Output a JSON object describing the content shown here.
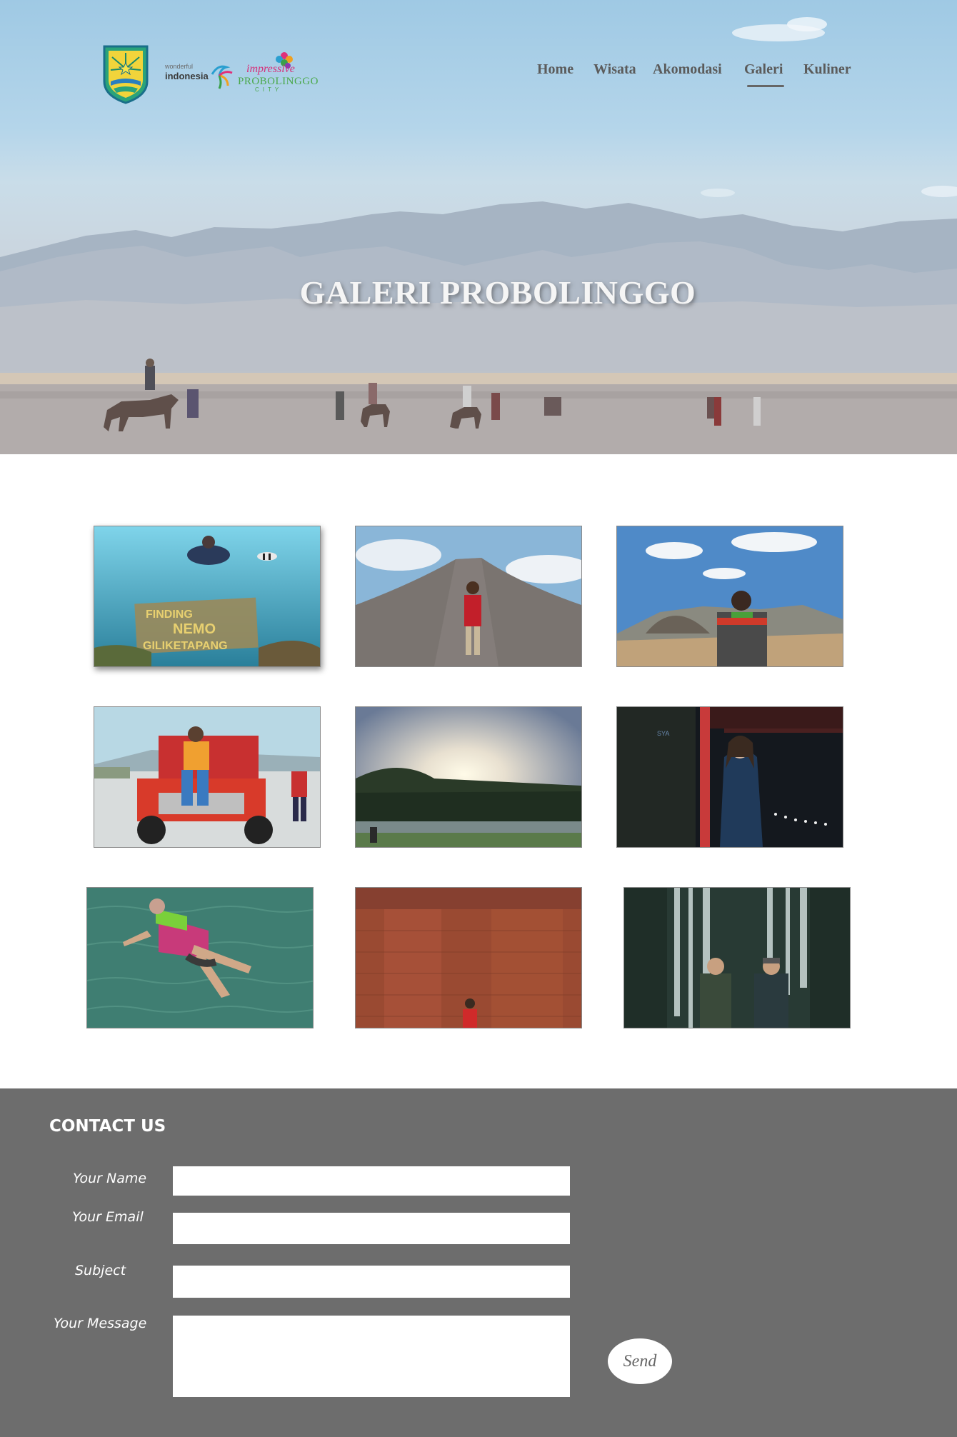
{
  "header": {
    "logos": {
      "crest": "probolinggo-crest",
      "wonderful_small": "wonderful",
      "wonderful_big": "indonesia",
      "impressive_l1": "impressive",
      "impressive_l2": "PROBOLINGGO",
      "impressive_l3": "CITY"
    },
    "nav": [
      {
        "label": "Home",
        "active": false
      },
      {
        "label": "Wisata",
        "active": false
      },
      {
        "label": "Akomodasi",
        "active": false
      },
      {
        "label": "Galeri",
        "active": true
      },
      {
        "label": "Kuliner",
        "active": false
      }
    ]
  },
  "hero": {
    "title": "GALERI PROBOLINGGO"
  },
  "gallery": {
    "photos": [
      {
        "subject": "underwater-diver-photo"
      },
      {
        "subject": "volcano-hiker-photo"
      },
      {
        "subject": "bromo-viewpoint-photo"
      },
      {
        "subject": "jeep-rider-photo"
      },
      {
        "subject": "lake-sunrise-photo"
      },
      {
        "subject": "night-portrait-photo"
      },
      {
        "subject": "floating-swimmer-photo"
      },
      {
        "subject": "brick-temple-photo"
      },
      {
        "subject": "waterfall-hikers-photo"
      }
    ]
  },
  "contact": {
    "title": "CONTACT US",
    "fields": {
      "name_label": "Your Name",
      "email_label": "Your Email",
      "subject_label": "Subject",
      "message_label": "Your Message",
      "name_value": "",
      "email_value": "",
      "subject_value": "",
      "message_value": ""
    },
    "send_label": "Send"
  },
  "colors": {
    "footer_bg": "#6d6d6d",
    "nav_text": "#5b5b5b",
    "hero_title": "#f5f5f5"
  }
}
